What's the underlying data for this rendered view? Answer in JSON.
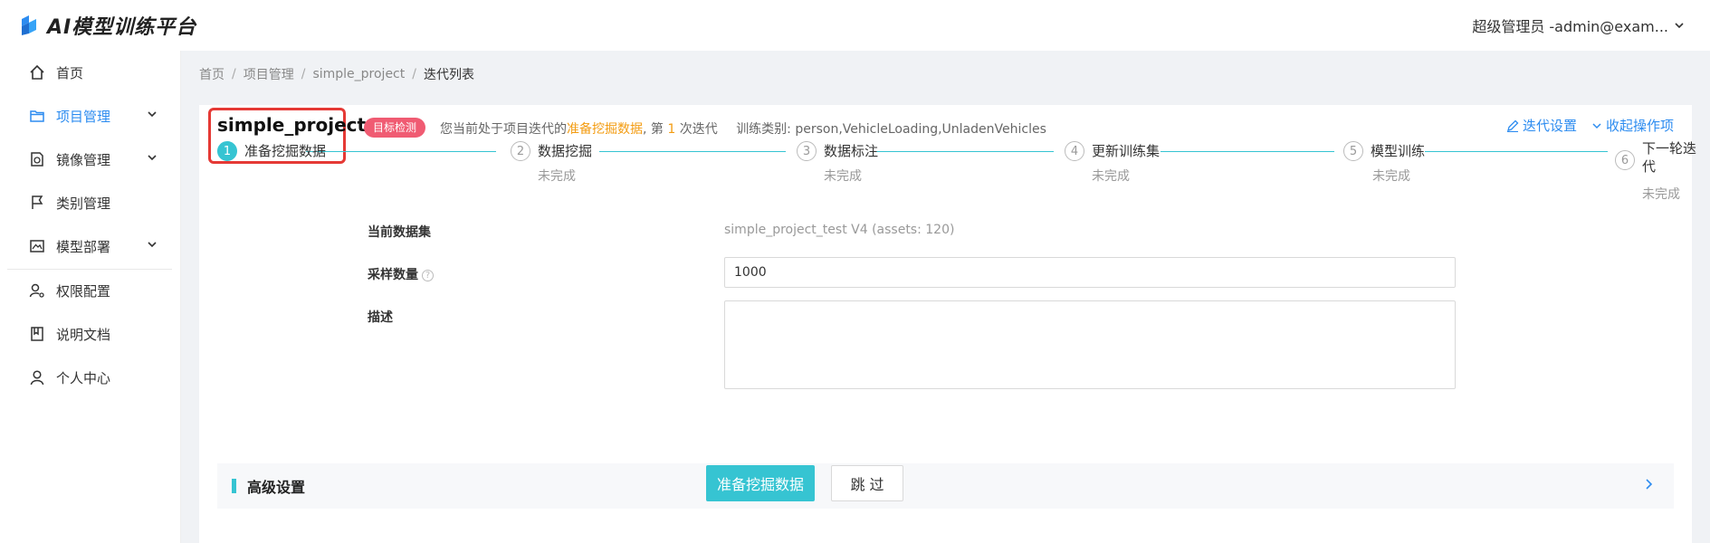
{
  "app": {
    "title": "AI模型训练平台"
  },
  "user": {
    "name": "超级管理员 -admin@exam..."
  },
  "sidebar": {
    "items": [
      {
        "label": "首页",
        "icon": "home-icon"
      },
      {
        "label": "项目管理",
        "icon": "folder-icon",
        "active": true,
        "expandable": true
      },
      {
        "label": "镜像管理",
        "icon": "image-file-icon",
        "expandable": true
      },
      {
        "label": "类别管理",
        "icon": "flag-icon"
      },
      {
        "label": "模型部署",
        "icon": "deploy-icon",
        "expandable": true
      },
      {
        "label": "权限配置",
        "icon": "user-gear-icon"
      },
      {
        "label": "说明文档",
        "icon": "book-icon"
      },
      {
        "label": "个人中心",
        "icon": "user-icon"
      }
    ]
  },
  "breadcrumb": [
    "首页",
    "项目管理",
    "simple_project",
    "迭代列表"
  ],
  "project": {
    "name": "simple_project",
    "tag": "目标检测",
    "stage_prefix": "您当前处于项目迭代的",
    "stage_name": "准备挖掘数据",
    "stage_mid": ", 第 ",
    "iteration": "1",
    "stage_suffix": " 次迭代",
    "classes_label": "训练类别: person,VehicleLoading,UnladenVehicles"
  },
  "actions": {
    "settings": "迭代设置",
    "collapse": "收起操作项"
  },
  "steps": [
    {
      "num": "1",
      "label": "准备挖掘数据",
      "status": "",
      "active": true
    },
    {
      "num": "2",
      "label": "数据挖掘",
      "status": "未完成"
    },
    {
      "num": "3",
      "label": "数据标注",
      "status": "未完成"
    },
    {
      "num": "4",
      "label": "更新训练集",
      "status": "未完成"
    },
    {
      "num": "5",
      "label": "模型训练",
      "status": "未完成"
    },
    {
      "num": "6",
      "label_line1": "下一轮迭",
      "label_line2": "代",
      "status": "未完成"
    }
  ],
  "form": {
    "dataset_label": "当前数据集",
    "dataset_value": "simple_project_test V4 (assets: 120)",
    "sample_label": "采样数量",
    "sample_value": "1000",
    "desc_label": "描述",
    "desc_value": ""
  },
  "advanced": {
    "title": "高级设置"
  },
  "buttons": {
    "primary": "准备挖掘数据",
    "skip": "跳 过"
  },
  "colors": {
    "accent": "#36c4d2",
    "link": "#2d8cf0",
    "tag": "#f05b72",
    "highlight": "#f39c12",
    "annotation": "#e53935"
  }
}
